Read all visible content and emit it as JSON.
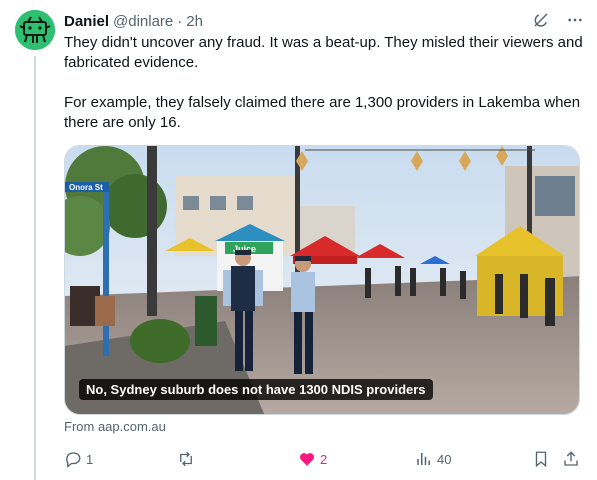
{
  "tweet": {
    "author_name": "Daniel",
    "author_handle": "@dinlare",
    "separator": "·",
    "time": "2h",
    "paragraphs": [
      "They didn't uncover any fraud. It was a beat-up. They misled their viewers and fabricated evidence.",
      "For example, they falsely claimed there are 1,300 providers in Lakemba when there are only 16."
    ]
  },
  "media": {
    "caption": "No, Sydney suburb does not have 1300 NDIS providers",
    "street_sign": "Onora St",
    "stall_sign": "Juice"
  },
  "card": {
    "source": "From aap.com.au"
  },
  "actions": {
    "replies": "1",
    "reposts": "",
    "likes": "2",
    "views": "40"
  },
  "icons": {
    "header": [
      "grok-icon",
      "more-icon"
    ],
    "actions": [
      "reply-icon",
      "repost-icon",
      "like-icon",
      "views-icon",
      "bookmark-icon",
      "share-icon"
    ]
  },
  "colors": {
    "avatar_bg": "#2fbf71",
    "like": "#f91880",
    "secondary_text": "#536471"
  }
}
